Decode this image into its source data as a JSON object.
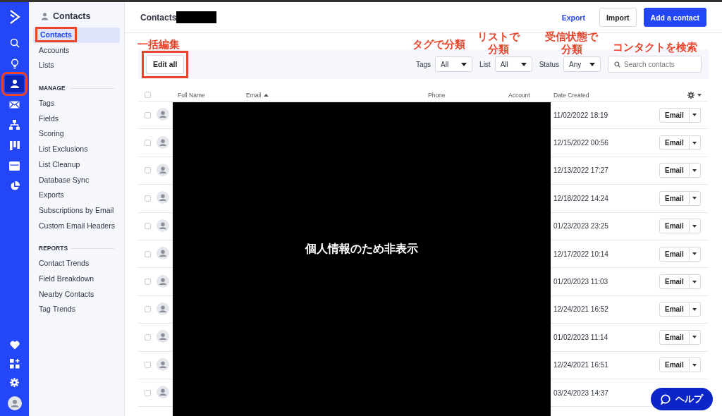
{
  "rail": {
    "items": [
      {
        "selected": false,
        "annotated": false
      },
      {
        "selected": false,
        "annotated": false
      },
      {
        "selected": true,
        "annotated": true
      },
      {
        "selected": false,
        "annotated": false
      },
      {
        "selected": false,
        "annotated": false
      },
      {
        "selected": false,
        "annotated": false
      },
      {
        "selected": false,
        "annotated": false
      },
      {
        "selected": false,
        "annotated": false
      }
    ]
  },
  "sidebar": {
    "title": "Contacts",
    "items": [
      {
        "label": "Contacts",
        "selected": true,
        "annotated": true
      },
      {
        "label": "Accounts",
        "selected": false,
        "annotated": false
      },
      {
        "label": "Lists",
        "selected": false,
        "annotated": false
      }
    ],
    "sections": [
      {
        "heading": "MANAGE",
        "items": [
          {
            "label": "Tags",
            "selected": false
          },
          {
            "label": "Fields",
            "selected": false
          },
          {
            "label": "Scoring",
            "selected": false
          },
          {
            "label": "List Exclusions",
            "selected": false
          },
          {
            "label": "List Cleanup",
            "selected": false
          },
          {
            "label": "Database Sync",
            "selected": false
          },
          {
            "label": "Exports",
            "selected": false
          },
          {
            "label": "Subscriptions by Email",
            "selected": false
          },
          {
            "label": "Custom Email Headers",
            "selected": false
          }
        ]
      },
      {
        "heading": "REPORTS",
        "items": [
          {
            "label": "Contact Trends",
            "selected": false
          },
          {
            "label": "Field Breakdown",
            "selected": false
          },
          {
            "label": "Nearby Contacts",
            "selected": false
          },
          {
            "label": "Tag Trends",
            "selected": false
          }
        ]
      }
    ]
  },
  "header": {
    "title": "Contacts",
    "export": "Export",
    "import": "Import",
    "add": "Add a contact"
  },
  "toolbar": {
    "edit_all": {
      "label": "Edit all",
      "annotated": true
    },
    "filters": [
      {
        "label": "Tags",
        "value": "All"
      },
      {
        "label": "List",
        "value": "All"
      },
      {
        "label": "Status",
        "value": "Any"
      }
    ],
    "search": {
      "placeholder": "Search contacts"
    }
  },
  "annotations": [
    {
      "kind": "edit",
      "text": "一括編集"
    },
    {
      "kind": "tags",
      "text": "タグで分類"
    },
    {
      "kind": "list",
      "lines": [
        "リストで",
        "分類"
      ]
    },
    {
      "kind": "status",
      "lines": [
        "受信状態で",
        "分類"
      ]
    },
    {
      "kind": "search",
      "text": "コンタクトを検索"
    }
  ],
  "table": {
    "select_all": {
      "checked": false
    },
    "columns": [
      {
        "label": "Full Name",
        "sorted": false
      },
      {
        "label": "Email",
        "sorted": true
      },
      {
        "label": "Phone",
        "sorted": false
      },
      {
        "label": "Account",
        "sorted": false
      },
      {
        "label": "Date Created",
        "sorted": false
      }
    ],
    "redaction": "個人情報のため非表示",
    "rows": [
      {
        "checked": false,
        "date": "11/02/2022 18:19",
        "action": "Email"
      },
      {
        "checked": false,
        "date": "12/15/2022 00:56",
        "action": "Email"
      },
      {
        "checked": false,
        "date": "12/13/2022 17:27",
        "action": "Email"
      },
      {
        "checked": false,
        "date": "12/18/2022 14:24",
        "action": "Email"
      },
      {
        "checked": false,
        "date": "01/23/2023 23:25",
        "action": "Email"
      },
      {
        "checked": false,
        "date": "12/17/2022 10:14",
        "action": "Email"
      },
      {
        "checked": false,
        "date": "01/20/2023 11:03",
        "action": "Email"
      },
      {
        "checked": false,
        "date": "12/24/2021 16:52",
        "action": "Email"
      },
      {
        "checked": false,
        "date": "01/02/2023 11:14",
        "action": "Email"
      },
      {
        "checked": false,
        "date": "12/24/2021 16:51",
        "action": "Email"
      },
      {
        "checked": false,
        "date": "03/24/2023 14:37"
      }
    ]
  },
  "help": {
    "label": "ヘルプ"
  }
}
